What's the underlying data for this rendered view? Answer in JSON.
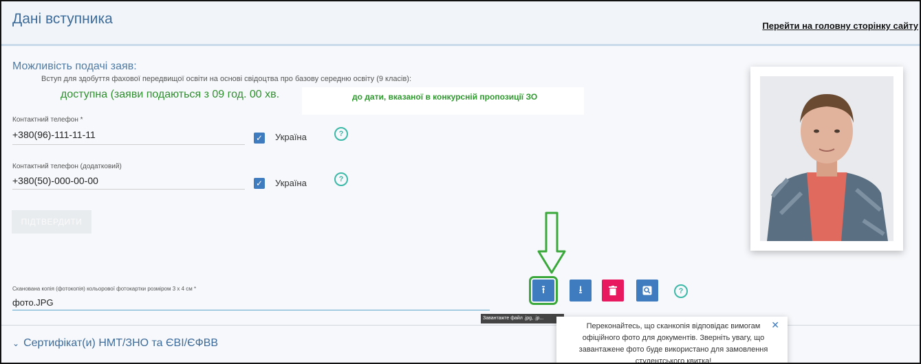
{
  "header": {
    "title": "Дані вступника",
    "main_link": "Перейти на головну сторінку сайту"
  },
  "admission": {
    "section_title": "Можливість подачі заяв:",
    "description": "Вступ для здобуття фахової передвищої освіти на основі свідоцтва про базову середню освіту (9 класів):",
    "status": "доступна (заяви подаються з 09 год. 00 хв.",
    "status_note": "до дати, вказаної в конкурсній пропозиції ЗО"
  },
  "phone": {
    "label": "Контактний телефон *",
    "value": "+380(96)-111-11-11",
    "country": "Україна",
    "country_checked": true
  },
  "phone_extra": {
    "label": "Контактний телефон (додатковий)",
    "value": "+380(50)-000-00-00",
    "country": "Україна",
    "country_checked": true
  },
  "confirm_button": "ПІДТВЕРДИТИ",
  "photo_upload": {
    "label": "Сканована копія (фотокопія) кольорової фотокартки розміром 3 х 4 см *",
    "value": "фото.JPG",
    "tooltip": "Завантажте файл .jpg, .jp...",
    "popover_text": "Переконайтесь, що сканкопія відповідає вимогам офіційного фото для документів. Зверніть увагу, що завантажене фото буде використано для замовлення студентського квитка!",
    "icons": {
      "upload": "upload-icon",
      "download": "download-icon",
      "delete": "trash-icon",
      "preview": "search-icon",
      "help": "help-icon",
      "close": "close-icon",
      "arrow": "arrow-down-icon"
    }
  },
  "certificates": {
    "title": "Сертифікат(и) НМТ/ЗНО та ЄВІ/ЄФВВ"
  },
  "colors": {
    "title_blue": "#3d6b9a",
    "status_green": "#2f8f2f",
    "button_blue": "#3f7bbf",
    "button_red": "#e8195e",
    "help_teal": "#3bb8a6",
    "arrow_green": "#3aa83a"
  }
}
